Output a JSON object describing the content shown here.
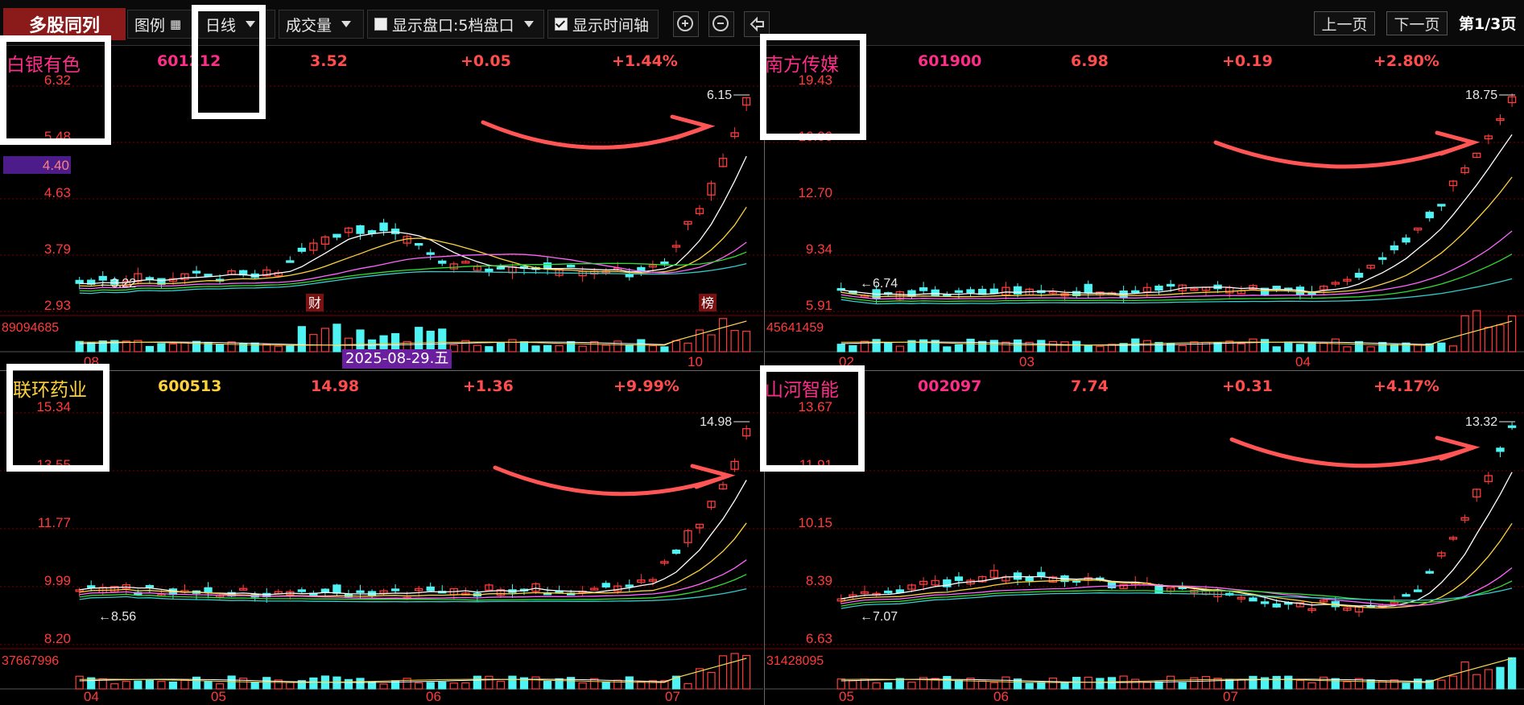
{
  "toolbar": {
    "title": "多股同列",
    "legend_label": "图例",
    "period_label": "日线",
    "indicator_label": "成交量",
    "depth_label": "显示盘口:5档盘口",
    "time_axis_label": "显示时间轴",
    "prev_label": "上一页",
    "next_label": "下一页",
    "page_label": "第1/3页"
  },
  "colors": {
    "up": "#ff3b3b",
    "down": "#4ff3f3",
    "grid": "#7a0000",
    "pink": "#ff2d8a",
    "yellow": "#ffd23c"
  },
  "panels": [
    {
      "name": "白银有色",
      "code": "601212",
      "price": "3.52",
      "change": "+0.05",
      "pct": "+1.44%",
      "name_color": "#ff2d8a",
      "code_color": "#ff2d8a",
      "y_labels": [
        "6.32",
        "5.48",
        "4.63",
        "3.79",
        "2.93"
      ],
      "current_level": "4.40",
      "high_mark": "6.15",
      "low_mark": "3.22",
      "volume_label": "89094685",
      "x_labels": [
        "08",
        "10"
      ],
      "badges": [
        "财",
        "榜"
      ],
      "date_tag": "2025-08-29.五"
    },
    {
      "name": "南方传媒",
      "code": "601900",
      "price": "6.98",
      "change": "+0.19",
      "pct": "+2.80%",
      "name_color": "#ff2d8a",
      "code_color": "#ff2d8a",
      "y_labels": [
        "19.43",
        "16.06",
        "12.70",
        "9.34",
        "5.91"
      ],
      "high_mark": "18.75",
      "low_mark": "6.74",
      "volume_label": "45641459",
      "x_labels": [
        "02",
        "03",
        "04"
      ]
    },
    {
      "name": "联环药业",
      "code": "600513",
      "price": "14.98",
      "change": "+1.36",
      "pct": "+9.99%",
      "name_color": "#ffd23c",
      "code_color": "#ffd23c",
      "y_labels": [
        "15.34",
        "13.55",
        "11.77",
        "9.99",
        "8.20"
      ],
      "high_mark": "14.98",
      "low_mark": "8.56",
      "volume_label": "37667996",
      "x_labels": [
        "04",
        "05",
        "06",
        "07"
      ]
    },
    {
      "name": "山河智能",
      "code": "002097",
      "price": "7.74",
      "change": "+0.31",
      "pct": "+4.17%",
      "name_color": "#ff2d8a",
      "code_color": "#ff2d8a",
      "y_labels": [
        "13.67",
        "11.91",
        "10.15",
        "8.39",
        "6.63"
      ],
      "high_mark": "13.32",
      "low_mark": "7.07",
      "volume_label": "31428095",
      "x_labels": [
        "05",
        "06",
        "07"
      ]
    }
  ]
}
